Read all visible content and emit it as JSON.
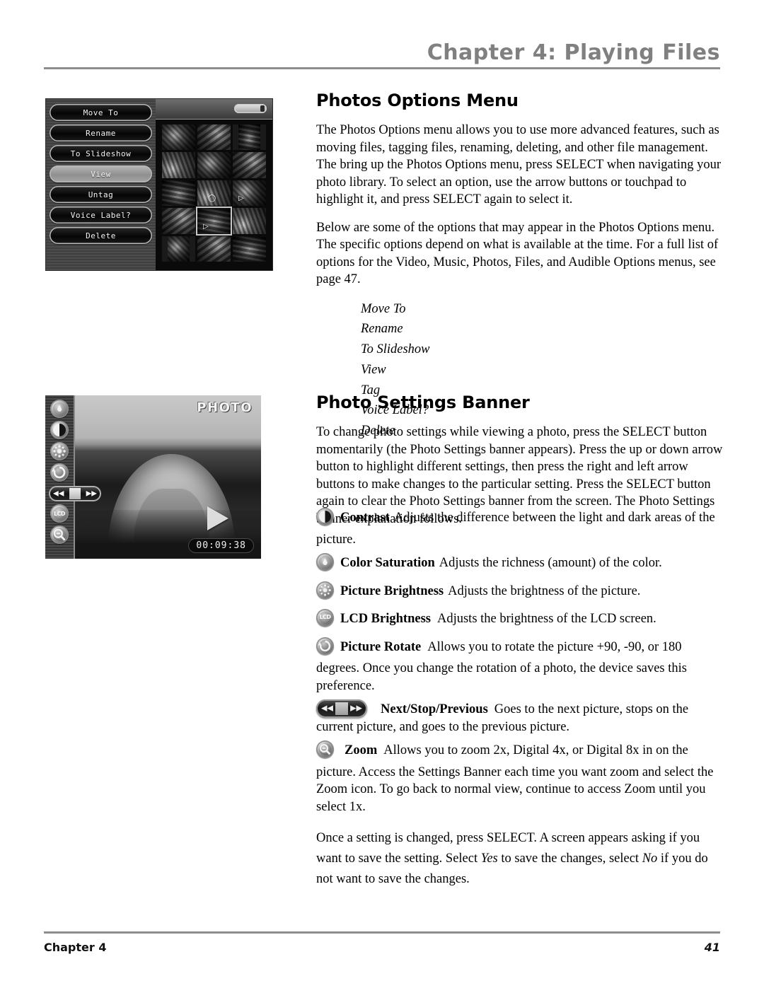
{
  "header": {
    "title": "Chapter 4: Playing Files"
  },
  "footer": {
    "chapter": "Chapter 4",
    "page_number": "41"
  },
  "section1": {
    "title": "Photos Options Menu",
    "paragraphs": [
      "The Photos Options menu allows you to use more advanced features, such as moving files, tagging files, renaming, deleting, and other file management. The bring up the Photos Options menu, press SELECT when navigating your photo library. To select an option, use the arrow buttons or touchpad to highlight it, and press SELECT again to select it.",
      "Below are some of the options that may appear in the Photos Options menu.  The specific options depend on what is available at the time. For a full list of options for the Video, Music, Photos, Files, and Audible Options menus, see page 47."
    ],
    "options": [
      "Move To",
      "Rename",
      "To Slideshow",
      "View",
      "Tag",
      "Voice Label?",
      "Delete"
    ]
  },
  "section2": {
    "title": "Photo Settings Banner",
    "paragraph": "To change photo settings while viewing a photo, press the SELECT button momentarily (the Photo Settings banner appears). Press the up or down arrow button to highlight different settings, then press the right and left arrow buttons to make changes to the particular setting. Press the SELECT button again to clear the Photo Settings banner from the screen. The Photo Settings banner explanation follows.",
    "definitions": [
      {
        "icon": "contrast-knob-icon",
        "term": "Contrast",
        "description": "Adjusts the difference between the light and dark areas of the picture."
      },
      {
        "icon": "color-saturation-knob-icon",
        "term": "Color Saturation",
        "description": "Adjusts the richness (amount) of the color."
      },
      {
        "icon": "picture-brightness-knob-icon",
        "term": "Picture Brightness",
        "description": "Adjusts the brightness of the picture."
      },
      {
        "icon": "lcd-brightness-knob-icon",
        "term": "LCD Brightness",
        "description": "Adjusts the brightness of the LCD screen."
      },
      {
        "icon": "picture-rotate-knob-icon",
        "term": "Picture Rotate",
        "description": "Allows you to rotate the picture +90, -90, or 180 degrees. Once you change the rotation of a photo, the device saves this preference."
      },
      {
        "icon": "next-stop-previous-pill-icon",
        "term": "Next/Stop/Previous",
        "description": "Goes to the next picture, stops on the current picture, and goes to the previous picture."
      },
      {
        "icon": "zoom-knob-icon",
        "term": "Zoom",
        "description": "Allows you to zoom 2x, Digital 4x, or Digital 8x in on the picture. Access the Settings Banner each time you want zoom and select the Zoom icon. To go back to normal view, continue to access Zoom until you select 1x."
      }
    ],
    "closing_paragraph_parts": {
      "a": "Once a setting is changed, press SELECT. A screen appears asking if you want to save the setting. Select ",
      "yes": "Yes",
      "b": " to save the changes, select ",
      "no": "No",
      "c": " if you do not want to save the changes."
    }
  },
  "figure_options_menu": {
    "menu_buttons": [
      {
        "label": "Move To",
        "selected": false
      },
      {
        "label": "Rename",
        "selected": false
      },
      {
        "label": "To Slideshow",
        "selected": false
      },
      {
        "label": "View",
        "selected": true
      },
      {
        "label": "Untag",
        "selected": false
      },
      {
        "label": "Voice Label?",
        "selected": false
      },
      {
        "label": "Delete",
        "selected": false
      }
    ],
    "thumbnail_grid": {
      "columns": 3,
      "rows": 5,
      "selected_index": 10
    }
  },
  "figure_settings_banner": {
    "mode_label": "PHOTO",
    "timecode": "00:09:38",
    "banner_icons": [
      "color-saturation-knob-icon",
      "contrast-knob-icon",
      "picture-brightness-knob-icon",
      "picture-rotate-knob-icon",
      "next-stop-previous-pill-icon",
      "lcd-brightness-knob-icon",
      "zoom-knob-icon"
    ]
  },
  "colors": {
    "header_gray": "#808080",
    "rule_gray": "#8d8d8d",
    "text_black": "#000000"
  }
}
